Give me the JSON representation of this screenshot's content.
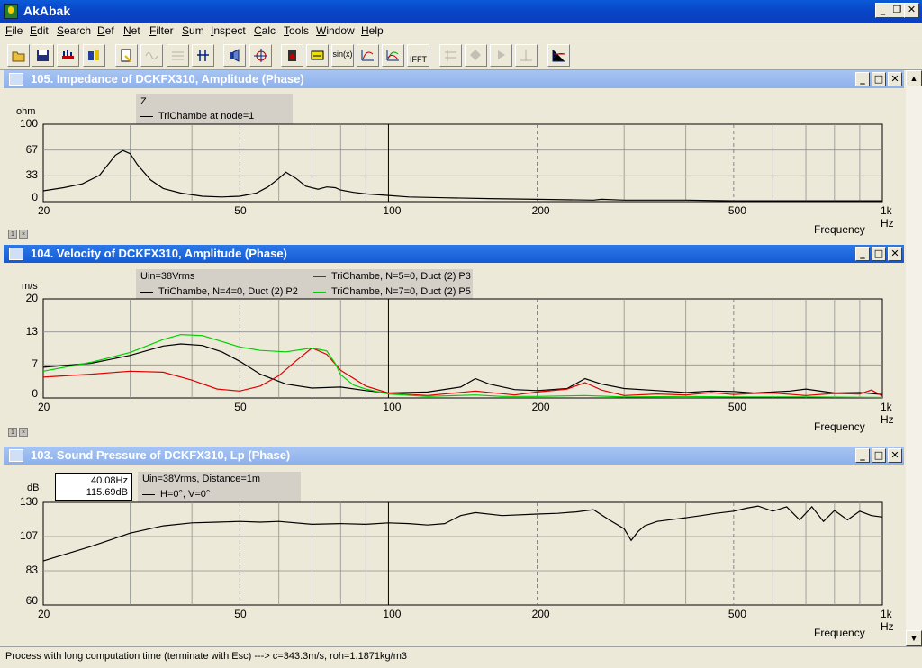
{
  "window": {
    "title": "AkAbak"
  },
  "menu": [
    "File",
    "Edit",
    "Search",
    "Def",
    "Net",
    "Filter",
    "Sum",
    "Inspect",
    "Calc",
    "Tools",
    "Window",
    "Help"
  ],
  "toolbar": {
    "sin_label": "sin(x)",
    "ifft_label": "IFFT",
    "icons": [
      "open-folder-icon",
      "save-disk-icon",
      "network-icon",
      "compile-icon",
      "page-icon",
      "wave-disabled-icon",
      "grid-disabled-icon",
      "range-icon",
      "speaker-icon",
      "node-target-icon",
      "driver-icon",
      "filter-icon",
      "sin-icon",
      "curve-icon",
      "curve-multi-icon",
      "ifft-icon",
      "pan-disabled-icon",
      "zoom-disabled-icon",
      "zoom-in-disabled-icon",
      "measure-disabled-icon",
      "chart-icon"
    ]
  },
  "status": {
    "text": "Process with long computation time (terminate with Esc) ---> c=343.3m/s, roh=1.1871kg/m3"
  },
  "colors": {
    "black": "#000000",
    "red": "#e00000",
    "green": "#00d000"
  },
  "readout": {
    "line1": "40.08Hz",
    "line2": "115.69dB"
  },
  "plots": [
    {
      "title": "105. Impedance of DCKFX310, Amplitude (Phase)",
      "unit": "ohm",
      "yticks": [
        "100",
        "67",
        "33",
        "0"
      ],
      "xticks": [
        "20",
        "50",
        "100",
        "200",
        "500",
        "1k"
      ],
      "xunit": "Hz",
      "xlabel": "Frequency",
      "legend_header": "Z",
      "legend": [
        "TriChambe at node=1"
      ]
    },
    {
      "title": "104. Velocity of DCKFX310, Amplitude (Phase)",
      "unit": "m/s",
      "yticks": [
        "20",
        "13",
        "7",
        "0"
      ],
      "xticks": [
        "20",
        "50",
        "100",
        "200",
        "500",
        "1k"
      ],
      "xunit": "Hz",
      "xlabel": "Frequency",
      "legend_header": "Uin=38Vrms",
      "legend": [
        "TriChambe, N=4=0, Duct (2) P2",
        "TriChambe, N=5=0, Duct (2) P3",
        "TriChambe, N=7=0, Duct (2) P5"
      ]
    },
    {
      "title": "103. Sound Pressure of DCKFX310, Lp (Phase)",
      "unit": "dB",
      "yticks": [
        "130",
        "107",
        "83",
        "60"
      ],
      "xticks": [
        "20",
        "50",
        "100",
        "200",
        "500",
        "1k"
      ],
      "xunit": "Hz",
      "xlabel": "Frequency",
      "legend_header": "Uin=38Vrms, Distance=1m",
      "legend": [
        "H=0°, V=0°"
      ]
    }
  ],
  "chart_data": [
    {
      "type": "line",
      "title": "105. Impedance of DCKFX310, Amplitude (Phase)",
      "xlabel": "Frequency",
      "ylabel": "ohm",
      "xscale": "log",
      "xlim": [
        20,
        1000
      ],
      "ylim": [
        0,
        100
      ],
      "grid": true,
      "series": [
        {
          "name": "TriChambe at node=1",
          "color": "#000000",
          "x": [
            20,
            22,
            24,
            26,
            28,
            29,
            30,
            31,
            33,
            35,
            38,
            42,
            46,
            50,
            54,
            57,
            60,
            62,
            65,
            68,
            72,
            75,
            78,
            80,
            85,
            90,
            100,
            110,
            130,
            160,
            200,
            260,
            270,
            300,
            400,
            500,
            700,
            1000
          ],
          "y": [
            14,
            18,
            23,
            34,
            60,
            66,
            62,
            48,
            28,
            17,
            11,
            7,
            6,
            7,
            11,
            19,
            30,
            38,
            30,
            20,
            16,
            19,
            18,
            15,
            12,
            10,
            8,
            6,
            5,
            4,
            3,
            2,
            3,
            2,
            2,
            1,
            1,
            1
          ]
        }
      ]
    },
    {
      "type": "line",
      "title": "104. Velocity of DCKFX310, Amplitude (Phase)",
      "xlabel": "Frequency",
      "ylabel": "m/s",
      "xscale": "log",
      "xlim": [
        20,
        1000
      ],
      "ylim": [
        0,
        20
      ],
      "grid": true,
      "series": [
        {
          "name": "TriChambe, N=4=0, Duct (2) P2",
          "color": "#000000",
          "x": [
            20,
            25,
            30,
            35,
            38,
            42,
            46,
            50,
            55,
            62,
            70,
            80,
            90,
            100,
            120,
            140,
            150,
            160,
            180,
            200,
            230,
            250,
            270,
            300,
            350,
            400,
            450,
            500,
            550,
            600,
            650,
            700,
            800,
            900,
            1000
          ],
          "y": [
            6.2,
            7.0,
            8.6,
            10.5,
            10.9,
            10.6,
            9.3,
            7.4,
            4.8,
            2.8,
            2.0,
            2.2,
            1.5,
            1.0,
            1.2,
            2.2,
            3.9,
            2.8,
            1.7,
            1.5,
            1.9,
            3.9,
            2.8,
            1.9,
            1.5,
            1.1,
            1.4,
            1.3,
            1.0,
            1.2,
            1.4,
            1.8,
            1.0,
            1.1,
            0.7
          ]
        },
        {
          "name": "TriChambe, N=5=0, Duct (2) P3",
          "color": "#e00000",
          "x": [
            20,
            25,
            30,
            35,
            40,
            45,
            50,
            55,
            60,
            65,
            70,
            75,
            80,
            90,
            100,
            120,
            150,
            180,
            200,
            230,
            250,
            270,
            300,
            350,
            400,
            450,
            500,
            550,
            600,
            700,
            800,
            900,
            950,
            1000
          ],
          "y": [
            4.2,
            4.8,
            5.4,
            5.2,
            3.6,
            1.8,
            1.4,
            2.4,
            4.5,
            7.5,
            10.1,
            8.8,
            5.6,
            2.4,
            1.0,
            0.5,
            1.4,
            0.6,
            1.2,
            1.8,
            3.1,
            1.6,
            0.5,
            0.8,
            0.6,
            1.1,
            0.7,
            0.9,
            1.0,
            0.5,
            0.9,
            0.8,
            1.6,
            0.4
          ]
        },
        {
          "name": "TriChambe, N=7=0, Duct (2) P5",
          "color": "#00d000",
          "x": [
            20,
            25,
            30,
            35,
            38,
            42,
            46,
            50,
            55,
            62,
            70,
            75,
            78,
            80,
            85,
            90,
            100,
            120,
            150,
            170,
            200,
            250,
            300,
            400,
            500,
            700,
            1000
          ],
          "y": [
            5.4,
            7.2,
            9.2,
            11.8,
            12.8,
            12.6,
            11.4,
            10.3,
            9.6,
            9.3,
            10.1,
            9.5,
            7.0,
            4.7,
            2.6,
            1.8,
            0.8,
            0.3,
            0.6,
            0.3,
            0.3,
            0.5,
            0.2,
            0.3,
            0.2,
            0.2,
            0.1
          ]
        }
      ]
    },
    {
      "type": "line",
      "title": "103. Sound Pressure of DCKFX310, Lp (Phase)",
      "xlabel": "Frequency",
      "ylabel": "dB",
      "xscale": "log",
      "xlim": [
        20,
        1000
      ],
      "ylim": [
        60,
        130
      ],
      "grid": true,
      "series": [
        {
          "name": "H=0°, V=0°",
          "color": "#000000",
          "x": [
            20,
            25,
            30,
            35,
            40,
            45,
            50,
            55,
            60,
            70,
            80,
            90,
            100,
            110,
            120,
            130,
            140,
            150,
            170,
            200,
            220,
            240,
            260,
            280,
            300,
            310,
            320,
            330,
            350,
            380,
            400,
            430,
            460,
            500,
            530,
            560,
            600,
            640,
            680,
            720,
            760,
            800,
            850,
            900,
            950,
            1000
          ],
          "y": [
            90,
            100,
            109,
            114,
            116,
            116.5,
            117,
            116.5,
            117,
            115,
            115.5,
            115,
            116,
            115.5,
            114.5,
            115.5,
            121,
            123,
            121,
            122,
            122.5,
            123.5,
            125,
            118,
            112,
            104,
            110,
            114,
            117,
            118.5,
            119.5,
            121,
            122.5,
            124,
            126,
            127.5,
            124,
            127,
            118,
            127,
            117,
            124.5,
            118,
            124,
            121,
            120
          ]
        }
      ]
    }
  ]
}
